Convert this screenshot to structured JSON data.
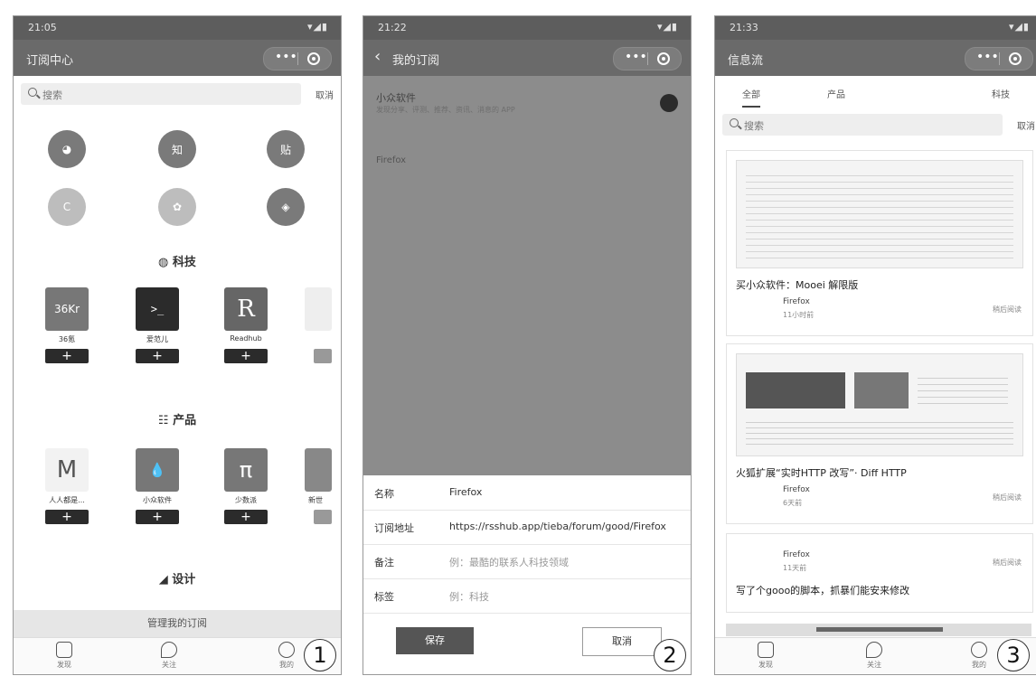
{
  "screen1": {
    "status_time": "21:05",
    "status_icons": "▾◢▮",
    "nav_title": "订阅中心",
    "capsule_dots": "•••",
    "search_placeholder": "搜索",
    "search_cancel": "取消",
    "circle_icons": [
      {
        "label": "◕",
        "tone": "dark"
      },
      {
        "label": "知",
        "tone": "dark"
      },
      {
        "label": "贴",
        "tone": "dark"
      },
      {
        "label": "C",
        "tone": "light"
      },
      {
        "label": "✿",
        "tone": "light"
      },
      {
        "label": "◈",
        "tone": "dark"
      }
    ],
    "section_tech": "科技",
    "tech_apps": [
      {
        "icon_text": "36Kr",
        "name": "36氪",
        "add": "+"
      },
      {
        "icon_text": ">_",
        "name": "爱范儿",
        "add": "+"
      },
      {
        "icon_text": "R",
        "name": "Readhub",
        "add": "+"
      },
      {
        "icon_text": "",
        "name": "",
        "add": ""
      }
    ],
    "section_product": "产品",
    "product_apps": [
      {
        "icon_text": "M",
        "name": "人人都是...",
        "add": "+"
      },
      {
        "icon_text": "💧",
        "name": "小众软件",
        "add": "+"
      },
      {
        "icon_text": "π",
        "name": "少数派",
        "add": "+"
      },
      {
        "icon_text": "",
        "name": "新世",
        "add": ""
      }
    ],
    "section_design": "设计",
    "manage_label": "管理我的订阅",
    "tabs": [
      {
        "label": "发现"
      },
      {
        "label": "关注"
      },
      {
        "label": "我的"
      }
    ],
    "badge": "1"
  },
  "screen2": {
    "status_time": "21:22",
    "status_icons": "▾◢▮",
    "nav_back": "‹",
    "nav_title": "我的订阅",
    "capsule_dots": "•••",
    "item1_title": "小众软件",
    "item1_sub": "发现分享、评测、推荐、资讯、消息的 APP",
    "item2_title": "Firefox",
    "form": {
      "name_label": "名称",
      "name_value": "Firefox",
      "url_label": "订阅地址",
      "url_value": "https://rsshub.app/tieba/forum/good/Firefox",
      "desc_label": "备注",
      "desc_placeholder": "例：最酷的联系人科技领域",
      "tag_label": "标签",
      "tag_placeholder": "例：科技"
    },
    "save_label": "保存",
    "cancel_label": "取消",
    "badge": "2"
  },
  "screen3": {
    "status_time": "21:33",
    "status_icons": "▾◢▮",
    "nav_title": "信息流",
    "capsule_dots": "•••",
    "tabs": [
      "全部",
      "产品",
      "科技"
    ],
    "search_placeholder": "搜索",
    "search_cancel": "取消",
    "cards": [
      {
        "title": "买小众软件：Mooei 解限版",
        "source": "Firefox",
        "time": "11小时前",
        "action": "稍后阅读"
      },
      {
        "title": "火狐扩展“实时HTTP 改写”· Diff HTTP",
        "source": "Firefox",
        "time": "6天前",
        "action": "稍后阅读"
      },
      {
        "title": "写了个gooo的脚本，抓暴们能安来修改",
        "source": "Firefox",
        "time": "11天前",
        "action": "稍后阅读"
      }
    ],
    "bottom_tabs": [
      {
        "label": "发现"
      },
      {
        "label": "关注"
      },
      {
        "label": "我的"
      }
    ],
    "badge": "3"
  }
}
